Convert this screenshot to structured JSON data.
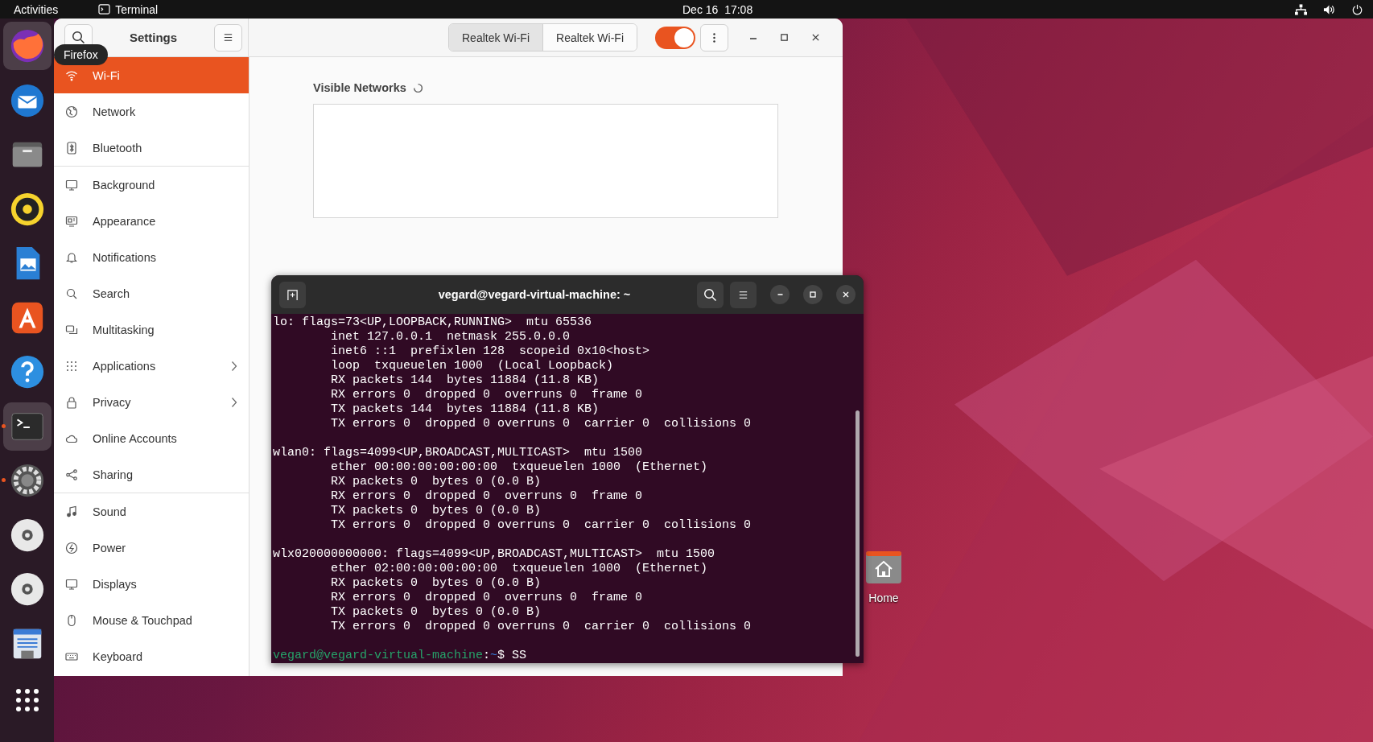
{
  "top_bar": {
    "activities": "Activities",
    "app_menu": "Terminal",
    "clock": "Dec 16  17:08"
  },
  "dock": {
    "tooltip": "Firefox",
    "items": [
      {
        "highlighted": true,
        "running": false
      },
      {
        "highlighted": false,
        "running": false
      },
      {
        "highlighted": false,
        "running": false
      },
      {
        "highlighted": false,
        "running": false
      },
      {
        "highlighted": false,
        "running": false
      },
      {
        "highlighted": false,
        "running": false
      },
      {
        "highlighted": false,
        "running": false
      },
      {
        "highlighted": true,
        "running": true
      },
      {
        "highlighted": false,
        "running": true
      },
      {
        "highlighted": false,
        "running": false
      },
      {
        "highlighted": false,
        "running": false
      },
      {
        "highlighted": false,
        "running": false
      }
    ]
  },
  "settings": {
    "title": "Settings",
    "sidebar": {
      "groups": [
        [
          {
            "label": "Wi-Fi",
            "selected": true,
            "submenu": false
          },
          {
            "label": "Network",
            "selected": false,
            "submenu": false
          },
          {
            "label": "Bluetooth",
            "selected": false,
            "submenu": false
          }
        ],
        [
          {
            "label": "Background",
            "selected": false,
            "submenu": false
          },
          {
            "label": "Appearance",
            "selected": false,
            "submenu": false
          },
          {
            "label": "Notifications",
            "selected": false,
            "submenu": false
          },
          {
            "label": "Search",
            "selected": false,
            "submenu": false
          },
          {
            "label": "Multitasking",
            "selected": false,
            "submenu": false
          },
          {
            "label": "Applications",
            "selected": false,
            "submenu": true
          },
          {
            "label": "Privacy",
            "selected": false,
            "submenu": true
          },
          {
            "label": "Online Accounts",
            "selected": false,
            "submenu": false
          },
          {
            "label": "Sharing",
            "selected": false,
            "submenu": false
          }
        ],
        [
          {
            "label": "Sound",
            "selected": false,
            "submenu": false
          },
          {
            "label": "Power",
            "selected": false,
            "submenu": false
          },
          {
            "label": "Displays",
            "selected": false,
            "submenu": false
          },
          {
            "label": "Mouse & Touchpad",
            "selected": false,
            "submenu": false
          },
          {
            "label": "Keyboard",
            "selected": false,
            "submenu": false
          }
        ]
      ]
    },
    "adapters": [
      {
        "label": "Realtek Wi-Fi",
        "selected": true
      },
      {
        "label": "Realtek Wi-Fi",
        "selected": false
      }
    ],
    "wifi_enabled": true,
    "visible_networks": {
      "heading": "Visible Networks"
    }
  },
  "terminal": {
    "title": "vegard@vegard-virtual-machine: ~",
    "blocks": [
      [
        "lo: flags=73<UP,LOOPBACK,RUNNING>  mtu 65536",
        "        inet 127.0.0.1  netmask 255.0.0.0",
        "        inet6 ::1  prefixlen 128  scopeid 0x10<host>",
        "        loop  txqueuelen 1000  (Local Loopback)",
        "        RX packets 144  bytes 11884 (11.8 KB)",
        "        RX errors 0  dropped 0  overruns 0  frame 0",
        "        TX packets 144  bytes 11884 (11.8 KB)",
        "        TX errors 0  dropped 0 overruns 0  carrier 0  collisions 0"
      ],
      [
        "wlan0: flags=4099<UP,BROADCAST,MULTICAST>  mtu 1500",
        "        ether 00:00:00:00:00:00  txqueuelen 1000  (Ethernet)",
        "        RX packets 0  bytes 0 (0.0 B)",
        "        RX errors 0  dropped 0  overruns 0  frame 0",
        "        TX packets 0  bytes 0 (0.0 B)",
        "        TX errors 0  dropped 0 overruns 0  carrier 0  collisions 0"
      ],
      [
        "wlx020000000000: flags=4099<UP,BROADCAST,MULTICAST>  mtu 1500",
        "        ether 02:00:00:00:00:00  txqueuelen 1000  (Ethernet)",
        "        RX packets 0  bytes 0 (0.0 B)",
        "        RX errors 0  dropped 0  overruns 0  frame 0",
        "        TX packets 0  bytes 0 (0.0 B)",
        "        TX errors 0  dropped 0 overruns 0  carrier 0  collisions 0"
      ]
    ],
    "prompt": {
      "user": "vegard@vegard-virtual-machine",
      "separator": ":",
      "path": "~",
      "input": "$ SS"
    }
  },
  "desktop": {
    "icons": [
      {
        "label": "Home"
      }
    ]
  }
}
